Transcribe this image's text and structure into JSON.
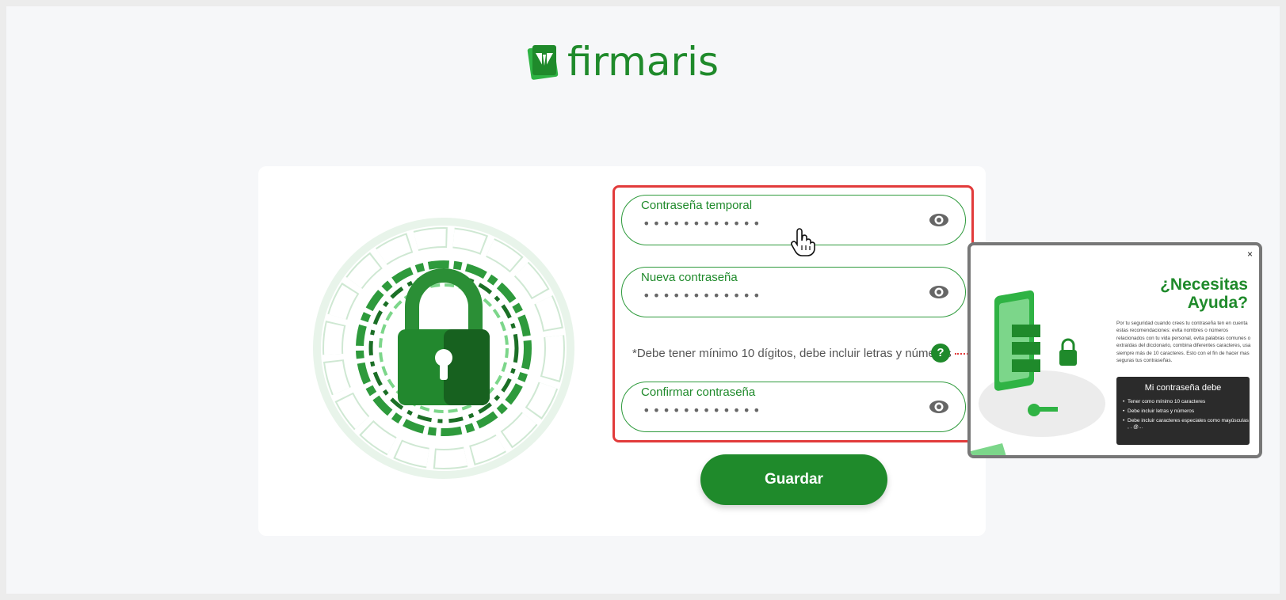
{
  "brand": {
    "name": "firmaris",
    "color": "#1f8a2b"
  },
  "form": {
    "fields": [
      {
        "label": "Contraseña temporal",
        "value": "••••••••••••",
        "icon": "eye-icon"
      },
      {
        "label": "Nueva contraseña",
        "value": "••••••••••••",
        "icon": "eye-icon"
      },
      {
        "label": "Confirmar contraseña",
        "value": "••••••••••••",
        "icon": "eye-icon"
      }
    ],
    "hint": "*Debe tener mínimo 10 dígitos, debe incluir letras y números",
    "help_label": "?",
    "save_label": "Guardar"
  },
  "help_popup": {
    "close_label": "×",
    "title_line1": "¿Necesitas",
    "title_line2": "Ayuda?",
    "text": "Por tu seguridad cuando crees tu contraseña ten en cuenta estas recomendaciones: evita nombres o números relacionados con tu vida personal, evita palabras comunes o extraídas del diccionario, combina diferentes caracteres, usa siempre más de 10 caracteres. Esto con el fin de hacer mas seguras tus contraseñas.",
    "rules_title": "Mi contraseña debe",
    "rules": [
      "Tener como mínimo 10 caracteres",
      "Debe incluir letras y números",
      "Debe incluir caracteres especiales como mayúsculas , . @..."
    ]
  },
  "colors": {
    "accent": "#1f8a2b",
    "highlight": "#e23b3b",
    "popup_border": "#777777"
  }
}
